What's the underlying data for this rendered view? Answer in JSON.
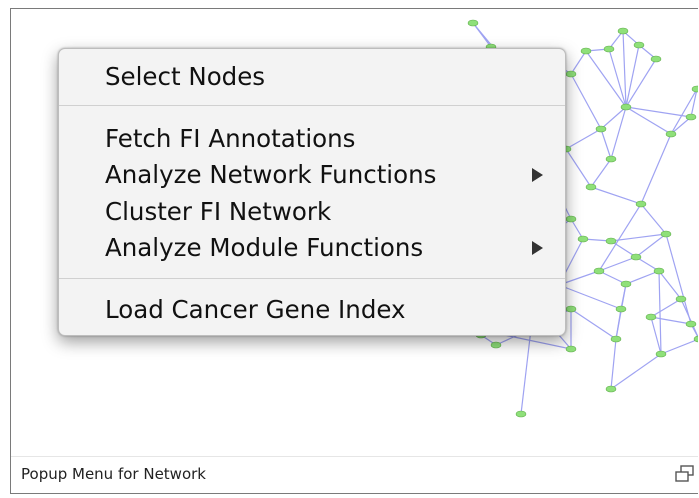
{
  "menu": {
    "groups": [
      {
        "items": [
          {
            "label": "Select Nodes",
            "submenu": false
          }
        ]
      },
      {
        "items": [
          {
            "label": "Fetch FI Annotations",
            "submenu": false
          },
          {
            "label": "Analyze Network Functions",
            "submenu": true
          },
          {
            "label": "Cluster FI Network",
            "submenu": false
          },
          {
            "label": "Analyze Module Functions",
            "submenu": true
          }
        ]
      },
      {
        "items": [
          {
            "label": "Load Cancer Gene Index",
            "submenu": false
          }
        ]
      }
    ]
  },
  "caption": "Popup Menu for Network",
  "icons": {
    "caption": "restore-window-icon",
    "submenu": "triangle-right-icon"
  },
  "colors": {
    "edge": "#9fa3f2",
    "node": "#8fe07a",
    "menu_bg": "#f3f3f3"
  }
}
